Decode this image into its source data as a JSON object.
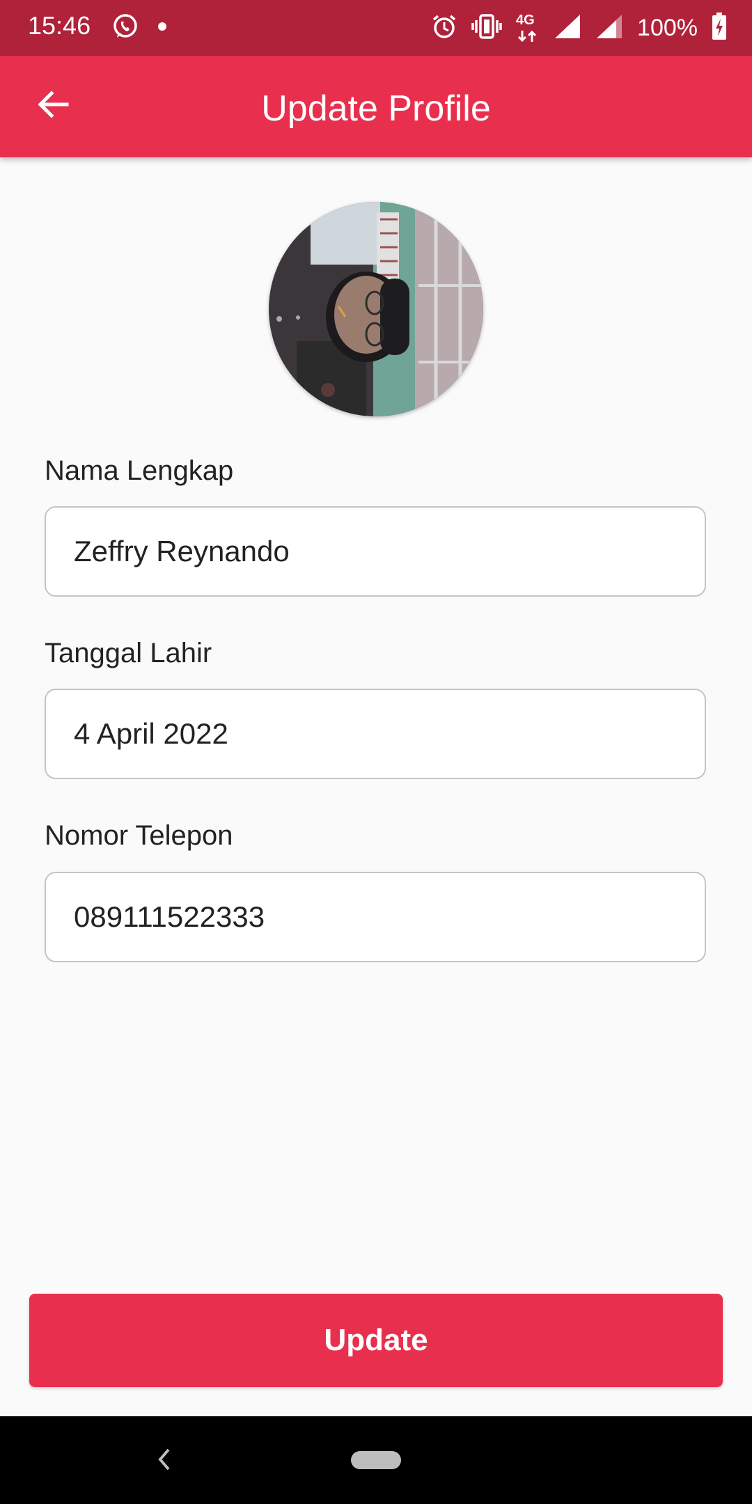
{
  "status_bar": {
    "time": "15:46",
    "network_label": "4G",
    "battery": "100%",
    "icons": [
      "whatsapp-icon",
      "dot-icon",
      "alarm-icon",
      "vibrate-icon",
      "network-4g-icon",
      "signal-icon",
      "signal-icon",
      "battery-charging-icon"
    ]
  },
  "app_bar": {
    "title": "Update Profile",
    "back_icon": "arrow-back-icon"
  },
  "profile": {
    "avatar_icon": "avatar-photo"
  },
  "form": {
    "fields": [
      {
        "label": "Nama Lengkap",
        "value": "Zeffry Reynando"
      },
      {
        "label": "Tanggal Lahir",
        "value": "4 April 2022"
      },
      {
        "label": "Nomor Telepon",
        "value": "089111522333"
      }
    ]
  },
  "actions": {
    "update_label": "Update"
  },
  "colors": {
    "status_bar": "#b0223a",
    "primary": "#e8304e",
    "background": "#fafafa",
    "field_border": "#c4c4c4"
  }
}
